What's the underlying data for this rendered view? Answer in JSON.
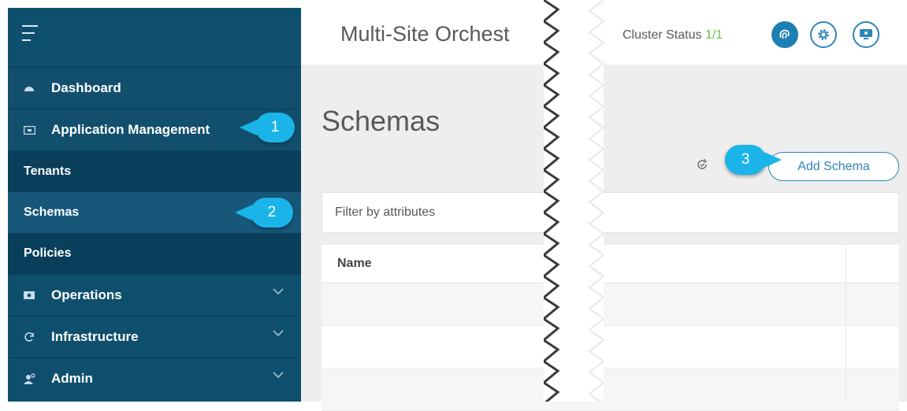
{
  "sidebar": {
    "dashboard": "Dashboard",
    "application_management": "Application Management",
    "sub_items": [
      "Tenants",
      "Schemas",
      "Policies"
    ],
    "operations": "Operations",
    "infrastructure": "Infrastructure",
    "admin": "Admin"
  },
  "header": {
    "app_title": "Multi-Site Orchest",
    "cluster_label": "Cluster Status",
    "cluster_value": "1/1"
  },
  "main": {
    "page_title": "Schemas",
    "add_button": "Add Schema",
    "filter_placeholder": "Filter by attributes",
    "table_header_name": "Name"
  },
  "callouts": [
    "1",
    "2",
    "3"
  ],
  "colors": {
    "sidebar": "#0f4f6e",
    "accent": "#2e86b8",
    "callout": "#1ab4e8",
    "status_ok": "#6cc04a"
  },
  "icons": {
    "menu": "hamburger-icon",
    "dashboard": "dashboard-icon",
    "application_management": "app-window-icon",
    "operations": "operations-icon",
    "infrastructure": "refresh-circle-icon",
    "admin": "admin-user-icon",
    "chevron": "chevron-down-icon",
    "fingerprint": "fingerprint-icon",
    "settings": "gear-icon",
    "monitor": "monitor-icon",
    "refresh": "refresh-icon"
  }
}
